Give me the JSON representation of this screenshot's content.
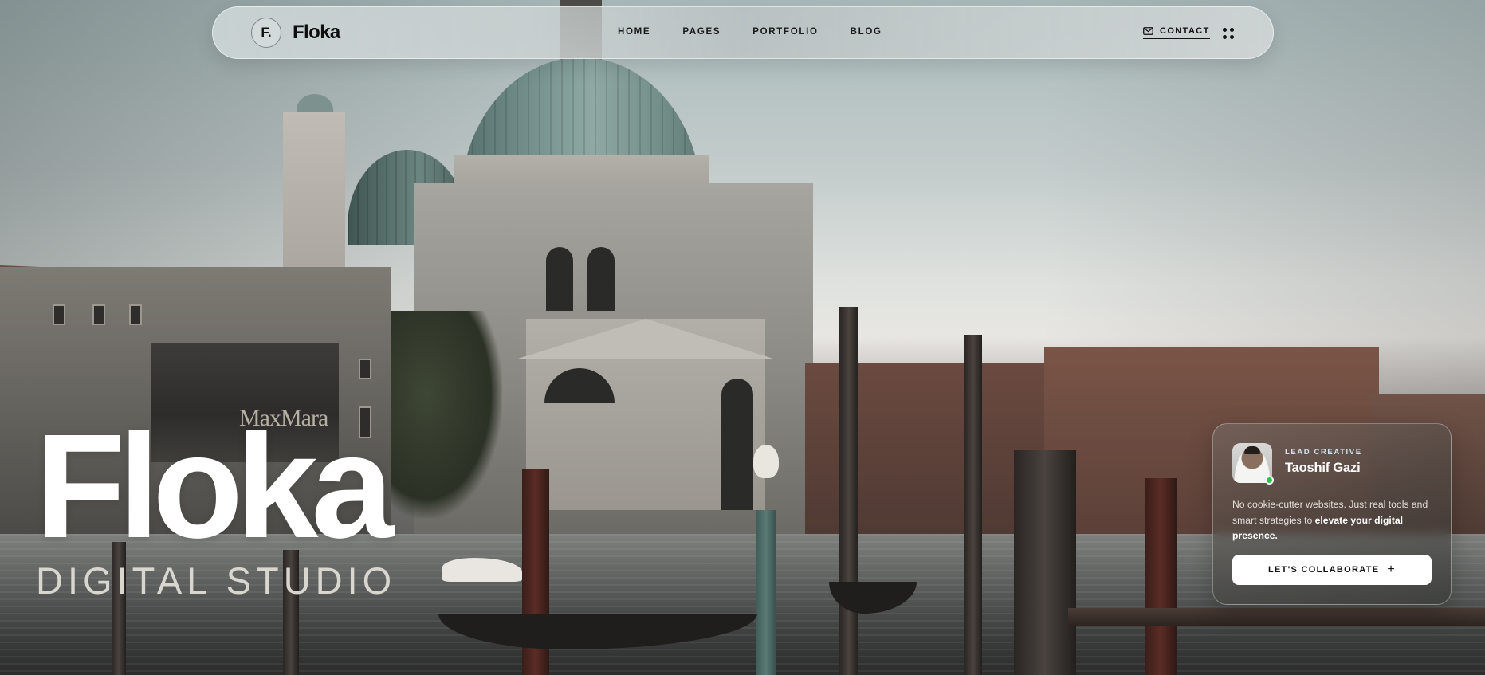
{
  "brand": {
    "mark": "F.",
    "name": "Floka"
  },
  "nav": {
    "items": [
      {
        "label": "HOME"
      },
      {
        "label": "PAGES"
      },
      {
        "label": "PORTFOLIO"
      },
      {
        "label": "BLOG"
      }
    ],
    "contact_label": "CONTACT",
    "contact_icon": "mail-icon",
    "menu_icon": "grid-dots-icon"
  },
  "hero": {
    "title": "Floka",
    "subtitle": "DIGITAL STUDIO",
    "background_sign": "MaxMara"
  },
  "profile_card": {
    "role": "LEAD CREATIVE",
    "name": "Taoshif Gazi",
    "description_start": "No cookie-cutter websites. Just real tools and smart strategies to ",
    "description_emphasis": "elevate your digital presence.",
    "cta_label": "LET'S COLLABORATE",
    "cta_icon": "plus-icon",
    "status": "online",
    "status_color": "#2fc24d"
  },
  "colors": {
    "accent_role": "#cfe2f2",
    "text_dark": "#111111",
    "text_light": "#ffffff"
  }
}
